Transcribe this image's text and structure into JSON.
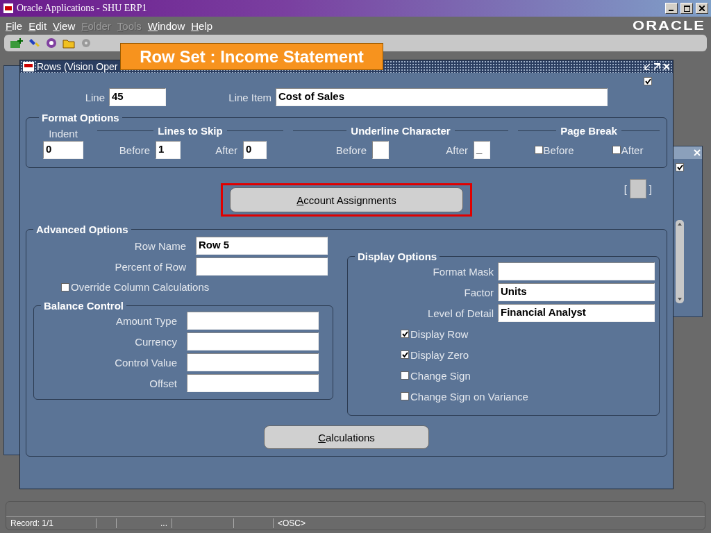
{
  "app_window": {
    "title": "Oracle Applications - SHU ERP1"
  },
  "menu": [
    {
      "label": "File",
      "disabled": false
    },
    {
      "label": "Edit",
      "disabled": false
    },
    {
      "label": "View",
      "disabled": false
    },
    {
      "label": "Folder",
      "disabled": true
    },
    {
      "label": "Tools",
      "disabled": true
    },
    {
      "label": "Window",
      "disabled": false
    },
    {
      "label": "Help",
      "disabled": false
    }
  ],
  "logo": "ORACLE",
  "banner": "Row Set : Income Statement",
  "background_window": {
    "checked": true
  },
  "form": {
    "title": "Rows (Vision Oper",
    "checked": true,
    "line": {
      "label": "Line",
      "value": "45"
    },
    "line_item": {
      "label": "Line Item",
      "value": "Cost of Sales"
    },
    "format_options": {
      "title": "Format Options",
      "indent": {
        "label": "Indent",
        "value": "0"
      },
      "lines_to_skip": {
        "title": "Lines to Skip",
        "before": {
          "label": "Before",
          "value": "1"
        },
        "after": {
          "label": "After",
          "value": "0"
        }
      },
      "underline_character": {
        "title": "Underline Character",
        "before": {
          "label": "Before"
        },
        "after": {
          "label": "After",
          "value": "_"
        }
      },
      "page_break": {
        "title": "Page Break",
        "options": [
          {
            "label": "Before",
            "checked": false
          },
          {
            "label": "After",
            "checked": false
          }
        ]
      }
    },
    "account_button": "Account Assignments",
    "brackets": [
      "[",
      "]"
    ],
    "advanced_options": {
      "title": "Advanced Options",
      "fields": [
        {
          "label": "Row Name",
          "value": "Row 5"
        },
        {
          "label": "Percent of Row"
        }
      ],
      "override": {
        "label": "Override Column Calculations",
        "checked": false
      },
      "balance_control": {
        "title": "Balance Control",
        "fields": [
          {
            "label": "Amount Type"
          },
          {
            "label": "Currency"
          },
          {
            "label": "Control Value"
          },
          {
            "label": "Offset"
          }
        ]
      },
      "display_options": {
        "title": "Display Options",
        "fields": [
          {
            "label": "Format Mask"
          },
          {
            "label": "Factor",
            "value": "Units"
          },
          {
            "label": "Level of Detail",
            "value": "Financial Analyst"
          }
        ],
        "checks": [
          {
            "label": "Display Row",
            "checked": true
          },
          {
            "label": "Display Zero",
            "checked": true
          },
          {
            "label": "Change Sign",
            "checked": false
          },
          {
            "label": "Change Sign on Variance",
            "checked": false
          }
        ]
      }
    },
    "calc_button": "Calculations"
  },
  "status_bar": {
    "record": "Record: 1/1",
    "cell_3": "...",
    "mode": "<OSC>"
  }
}
